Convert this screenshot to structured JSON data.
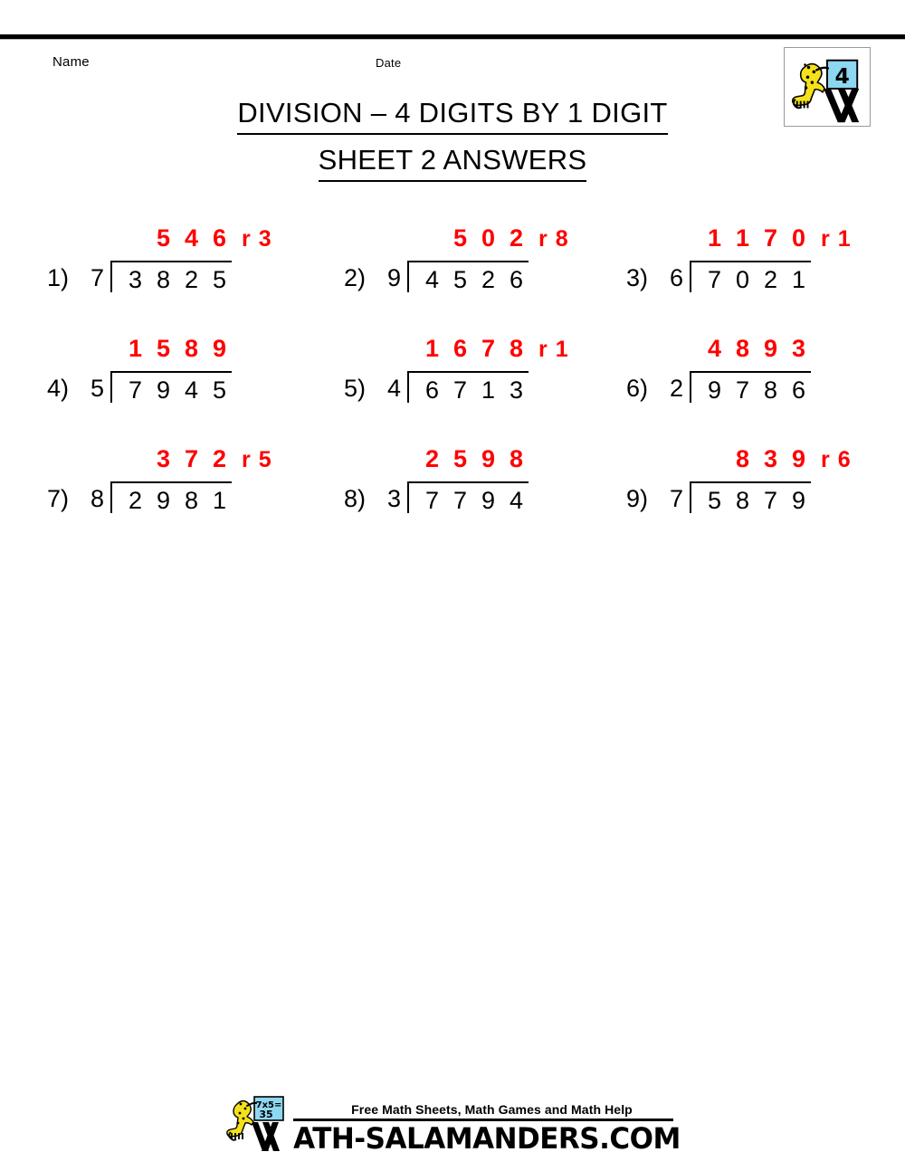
{
  "header": {
    "name_label": "Name",
    "date_label": "Date"
  },
  "grade_logo": {
    "grade_number": "4",
    "icon": "salamander-easel-logo"
  },
  "title": {
    "line1": "DIVISION – 4 DIGITS BY 1 DIGIT",
    "line2": "SHEET 2 ANSWERS"
  },
  "colors": {
    "answer_red": "#FF0000",
    "ink_black": "#000000",
    "board_blue": "#8ED7F0"
  },
  "problems": [
    {
      "number": "1)",
      "divisor": "7",
      "dividend": [
        "3",
        "8",
        "2",
        "5"
      ],
      "quotient": [
        "",
        "5",
        "4",
        "6"
      ],
      "remainder": "r 3"
    },
    {
      "number": "2)",
      "divisor": "9",
      "dividend": [
        "4",
        "5",
        "2",
        "6"
      ],
      "quotient": [
        "",
        "5",
        "0",
        "2"
      ],
      "remainder": "r 8"
    },
    {
      "number": "3)",
      "divisor": "6",
      "dividend": [
        "7",
        "0",
        "2",
        "1"
      ],
      "quotient": [
        "1",
        "1",
        "7",
        "0"
      ],
      "remainder": "r 1"
    },
    {
      "number": "4)",
      "divisor": "5",
      "dividend": [
        "7",
        "9",
        "4",
        "5"
      ],
      "quotient": [
        "1",
        "5",
        "8",
        "9"
      ],
      "remainder": ""
    },
    {
      "number": "5)",
      "divisor": "4",
      "dividend": [
        "6",
        "7",
        "1",
        "3"
      ],
      "quotient": [
        "1",
        "6",
        "7",
        "8"
      ],
      "remainder": "r 1"
    },
    {
      "number": "6)",
      "divisor": "2",
      "dividend": [
        "9",
        "7",
        "8",
        "6"
      ],
      "quotient": [
        "4",
        "8",
        "9",
        "3"
      ],
      "remainder": ""
    },
    {
      "number": "7)",
      "divisor": "8",
      "dividend": [
        "2",
        "9",
        "8",
        "1"
      ],
      "quotient": [
        "",
        "3",
        "7",
        "2"
      ],
      "remainder": "r 5"
    },
    {
      "number": "8)",
      "divisor": "3",
      "dividend": [
        "7",
        "7",
        "9",
        "4"
      ],
      "quotient": [
        "2",
        "5",
        "9",
        "8"
      ],
      "remainder": ""
    },
    {
      "number": "9)",
      "divisor": "7",
      "dividend": [
        "5",
        "8",
        "7",
        "9"
      ],
      "quotient": [
        "",
        "8",
        "3",
        "9"
      ],
      "remainder": "r 6"
    }
  ],
  "footer": {
    "tagline": "Free Math Sheets, Math Games and Math Help",
    "url": "ATH-SALAMANDERS.COM",
    "logo_board_text_top": "7x5=",
    "logo_board_text_bottom": "35",
    "icon": "salamander-easel-logo"
  }
}
